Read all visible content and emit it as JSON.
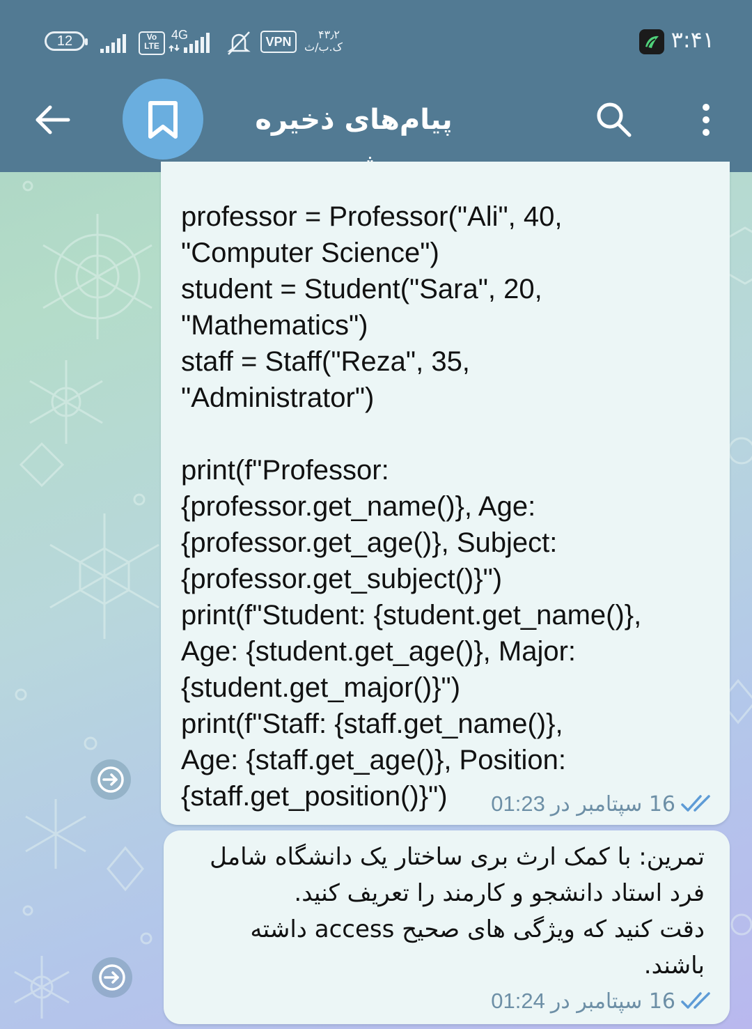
{
  "status_bar": {
    "battery": "12",
    "network": "4G",
    "volte": "Vo\nLTE",
    "vpn": "VPN",
    "speed_value": "۴۳٫۲",
    "speed_unit": "ک.ب/ث",
    "time": "۳:۴۱"
  },
  "header": {
    "title": "پیام‌های ذخیره شده",
    "avatar_icon": "bookmark-icon",
    "back_icon": "arrow-left-icon",
    "search_icon": "search-icon",
    "menu_icon": "more-vertical-icon",
    "bar_color": "#527a93",
    "avatar_color": "#6aaedf"
  },
  "messages": [
    {
      "lines": [
        "professor = Professor(\"Ali\", 40,",
        "\"Computer Science\")",
        "student = Student(\"Sara\", 20,",
        "\"Mathematics\")",
        "staff = Staff(\"Reza\", 35,",
        "\"Administrator\")",
        "",
        "print(f\"Professor:",
        "{professor.get_name()}, Age:",
        "{professor.get_age()}, Subject:",
        "{professor.get_subject()}\")",
        "print(f\"Student: {student.get_name()},",
        "Age: {student.get_age()}, Major:",
        "{student.get_major()}\")",
        "print(f\"Staff: {staff.get_name()},",
        "Age: {staff.get_age()}, Position:",
        "{staff.get_position()}\")"
      ],
      "date": "16 سپتامبر در",
      "time": "01:23",
      "status_icon": "double-check-icon"
    },
    {
      "lines": [
        "تمرین: با کمک ارث بری ساختار یک دانشگاه شامل",
        "فرد استاد دانشجو و کارمند را تعریف کنید.",
        "دقت کنید که ویژگی های صحیح access داشته",
        "باشند."
      ],
      "date": "16 سپتامبر در",
      "time": "01:24",
      "status_icon": "double-check-icon"
    }
  ],
  "share_icon": "forward-arrow-icon"
}
